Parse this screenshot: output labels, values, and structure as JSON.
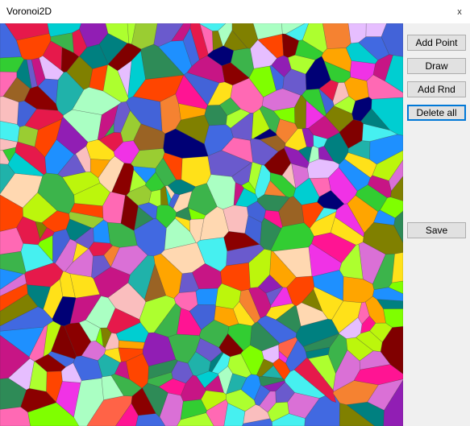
{
  "window": {
    "title": "Voronoi2D",
    "close_glyph": "x",
    "close_icon": "close-icon"
  },
  "buttons": {
    "add_point": "Add Point",
    "draw": "Draw",
    "add_rnd": "Add Rnd",
    "delete_all": "Delete all",
    "save": "Save"
  },
  "canvas": {
    "description_colors": [
      "#e6194b",
      "#3cb44b",
      "#ffe119",
      "#4363d8",
      "#f58231",
      "#911eb4",
      "#46f0f0",
      "#f032e6",
      "#bcf60c",
      "#fabebe",
      "#008080",
      "#e6beff",
      "#9a6324",
      "#800000",
      "#aaffc3",
      "#808000",
      "#ffd8b1",
      "#000075",
      "#2e8b57",
      "#ff69b4",
      "#7fff00",
      "#1e90ff",
      "#ff4500",
      "#da70d6",
      "#00ced1",
      "#9acd32",
      "#ff1493",
      "#32cd32",
      "#4169e1",
      "#ffa500",
      "#8b0000",
      "#20b2aa",
      "#c71585",
      "#6a5acd",
      "#adff2f",
      "#ff6347"
    ]
  }
}
